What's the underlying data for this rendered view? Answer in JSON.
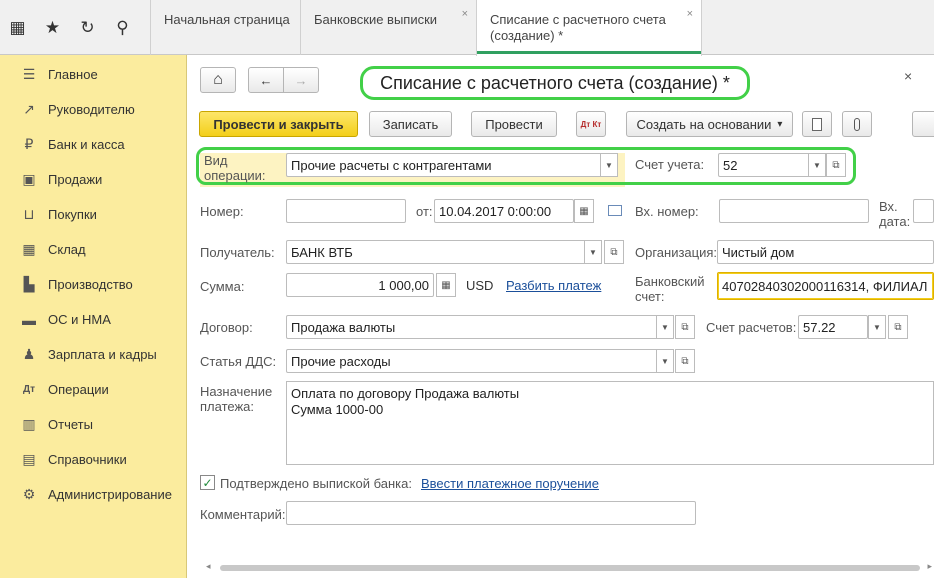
{
  "topbar": {
    "icons": [
      "apps-grid-icon",
      "star-icon",
      "history-icon",
      "search-icon"
    ],
    "icon_glyphs": [
      "▦",
      "★",
      "↻",
      "⚲"
    ],
    "tabs": [
      {
        "label": "Начальная страница"
      },
      {
        "label": "Банковские выписки",
        "close": "×"
      },
      {
        "label_line1": "Списание с расчетного счета",
        "label_line2": "(создание) *",
        "close": "×"
      }
    ]
  },
  "sidebar": {
    "items": [
      {
        "label": "Главное",
        "icon": "menu-icon",
        "glyph": "☰"
      },
      {
        "label": "Руководителю",
        "icon": "chart-line-icon",
        "glyph": "↗"
      },
      {
        "label": "Банк и касса",
        "icon": "ruble-coin-icon",
        "glyph": "₽"
      },
      {
        "label": "Продажи",
        "icon": "bag-icon",
        "glyph": "▣"
      },
      {
        "label": "Покупки",
        "icon": "cart-icon",
        "glyph": "⊔"
      },
      {
        "label": "Склад",
        "icon": "warehouse-icon",
        "glyph": "▦"
      },
      {
        "label": "Производство",
        "icon": "factory-icon",
        "glyph": "▙"
      },
      {
        "label": "ОС и НМА",
        "icon": "truck-icon",
        "glyph": "▬"
      },
      {
        "label": "Зарплата и кадры",
        "icon": "people-icon",
        "glyph": "♟"
      },
      {
        "label": "Операции",
        "icon": "dt-kt-icon",
        "glyph": "Дт"
      },
      {
        "label": "Отчеты",
        "icon": "bar-chart-icon",
        "glyph": "▥"
      },
      {
        "label": "Справочники",
        "icon": "book-icon",
        "glyph": "▤"
      },
      {
        "label": "Администрирование",
        "icon": "gear-icon",
        "glyph": "⚙"
      }
    ]
  },
  "header": {
    "home_glyph": "⌂",
    "back_glyph": "←",
    "forward_glyph": "→",
    "title": "Списание с расчетного счета (создание) *",
    "close_glyph": "×"
  },
  "toolbar": {
    "post_close": "Провести и закрыть",
    "save": "Записать",
    "post": "Провести",
    "dt_kt": "Дт Кт",
    "create_based": "Создать на основании",
    "create_based_arrow": "▾"
  },
  "form": {
    "operation_type_label": "Вид операции:",
    "operation_type_value": "Прочие расчеты с контрагентами",
    "account_label": "Счет учета:",
    "account_value": "52",
    "number_label": "Номер:",
    "number_value": "",
    "from_label": "от:",
    "date_value": "10.04.2017  0:00:00",
    "incoming_number_label": "Вх. номер:",
    "incoming_number_value": "",
    "incoming_date_label": "Вх. дата:",
    "recipient_label": "Получатель:",
    "recipient_value": "БАНК ВТБ",
    "organization_label": "Организация:",
    "organization_value": "Чистый дом",
    "amount_label": "Сумма:",
    "amount_value": "1 000,00",
    "currency": "USD",
    "split_payment_link": "Разбить платеж",
    "bank_account_label": "Банковский счет:",
    "bank_account_value": "40702840302000116314, ФИЛИАЛ",
    "contract_label": "Договор:",
    "contract_value": "Продажа валюты",
    "settlement_account_label": "Счет расчетов:",
    "settlement_account_value": "57.22",
    "dds_label": "Статья ДДС:",
    "dds_value": "Прочие расходы",
    "purpose_label": "Назначение платежа:",
    "purpose_line1": "Оплата по договору Продажа валюты",
    "purpose_line2": "Сумма 1000-00",
    "confirmed_label": "Подтверждено выпиской банка:",
    "confirmed_checked": true,
    "enter_payment_order_link": "Ввести платежное поручение",
    "comment_label": "Комментарий:",
    "comment_value": ""
  },
  "colors": {
    "sidebar_bg": "#fbec9e",
    "primary_button": "#f3cf1a",
    "highlight_outline": "#42d048",
    "link": "#1b4f9a"
  }
}
